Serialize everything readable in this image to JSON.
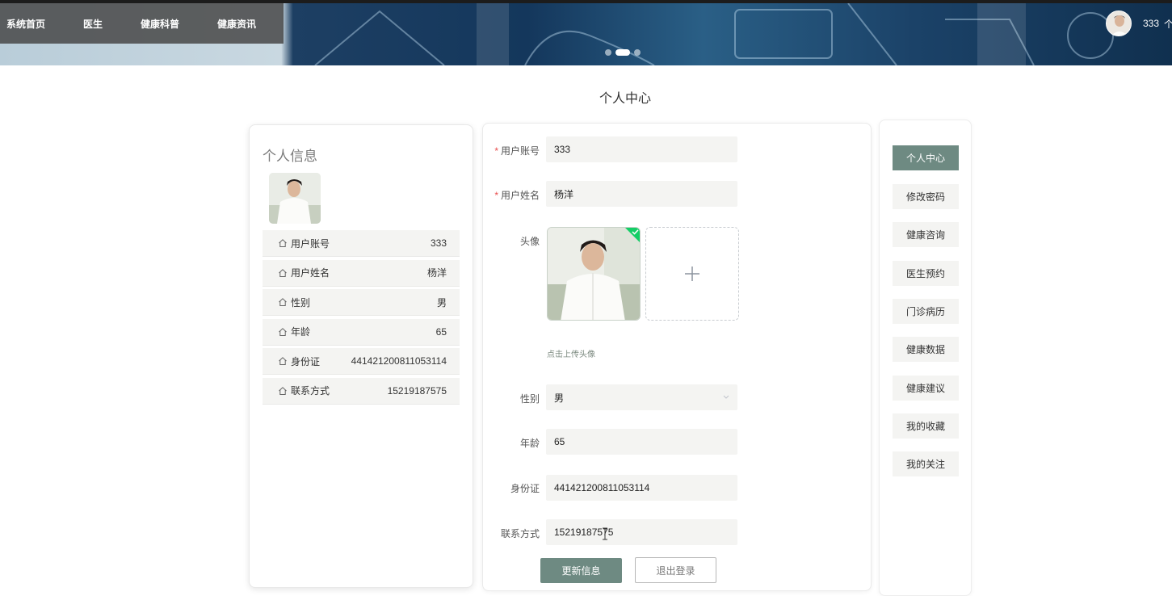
{
  "nav": {
    "items": [
      "系统首页",
      "医生",
      "健康科普",
      "健康资讯"
    ],
    "user_name": "333",
    "user_menu_partial": "个"
  },
  "page": {
    "title": "个人中心"
  },
  "profile_card": {
    "title": "个人信息",
    "rows": [
      {
        "label": "用户账号",
        "value": "333"
      },
      {
        "label": "用户姓名",
        "value": "杨洋"
      },
      {
        "label": "性别",
        "value": "男"
      },
      {
        "label": "年龄",
        "value": "65"
      },
      {
        "label": "身份证",
        "value": "441421200811053114"
      },
      {
        "label": "联系方式",
        "value": "15219187575"
      }
    ]
  },
  "form": {
    "account": {
      "label": "用户账号",
      "value": "333",
      "required": true
    },
    "name": {
      "label": "用户姓名",
      "value": "杨洋",
      "required": true
    },
    "avatar": {
      "label": "头像",
      "tip": "点击上传头像"
    },
    "gender": {
      "label": "性别",
      "value": "男"
    },
    "age": {
      "label": "年龄",
      "value": "65"
    },
    "id_card": {
      "label": "身份证",
      "value": "441421200811053114"
    },
    "phone": {
      "label": "联系方式",
      "value": "15219187575"
    },
    "update_button": "更新信息",
    "logout_button": "退出登录"
  },
  "side_menu": {
    "items": [
      "个人中心",
      "修改密码",
      "健康咨询",
      "医生预约",
      "门诊病历",
      "健康数据",
      "健康建议",
      "我的收藏",
      "我的关注"
    ],
    "active_index": 0
  },
  "colors": {
    "accent": "#6e8a82",
    "required": "#e84c4c",
    "nav_overlay": "#484848"
  },
  "icons": {
    "row_icon": "home-outline-icon",
    "add": "plus-icon",
    "select": "chevron-down-icon",
    "uploaded": "check-icon"
  }
}
